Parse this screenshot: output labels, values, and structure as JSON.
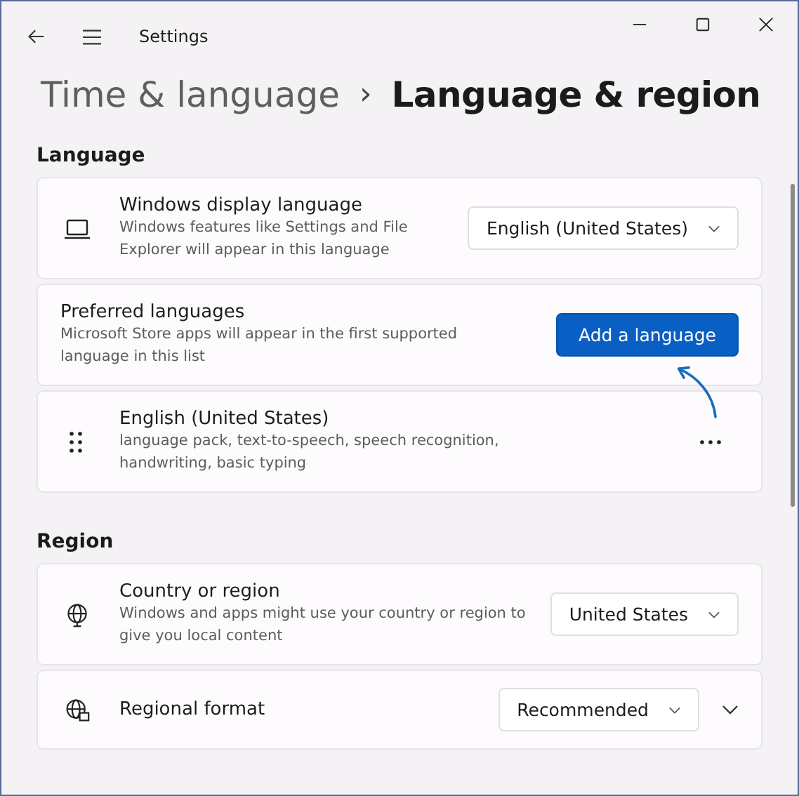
{
  "window": {
    "title": "Settings"
  },
  "breadcrumb": {
    "parent": "Time & language",
    "separator": "›",
    "current": "Language & region"
  },
  "sections": [
    {
      "heading": "Language",
      "rows": [
        {
          "kind": "dropdown",
          "title": "Windows display language",
          "description": "Windows features like Settings and File Explorer will appear in this language",
          "value": "English (United States)"
        },
        {
          "kind": "button",
          "title": "Preferred languages",
          "description": "Microsoft Store apps will appear in the first supported language in this list",
          "button": "Add a language"
        },
        {
          "kind": "item",
          "title": "English (United States)",
          "description": "language pack, text-to-speech, speech recognition, handwriting, basic typing"
        }
      ]
    },
    {
      "heading": "Region",
      "rows": [
        {
          "kind": "dropdown",
          "title": "Country or region",
          "description": "Windows and apps might use your country or region to give you local content",
          "value": "United States"
        },
        {
          "kind": "dropdown",
          "title": "Regional format",
          "value": "Recommended",
          "expandable": true
        }
      ]
    }
  ]
}
